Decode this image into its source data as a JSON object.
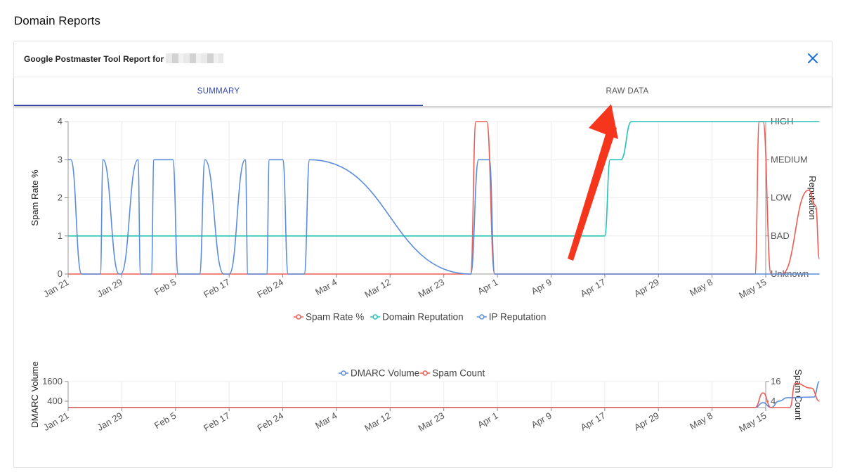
{
  "page": {
    "title": "Domain Reports"
  },
  "report": {
    "title": "Google Postmaster Tool Report for"
  },
  "tabs": [
    {
      "label": "SUMMARY",
      "active": true
    },
    {
      "label": "RAW DATA",
      "active": false
    }
  ],
  "annotation": {
    "type": "red-arrow",
    "color": "#f5351c",
    "target": "RAW DATA tab"
  },
  "chart_data": [
    {
      "type": "line",
      "x_ticks": [
        "Jan 21",
        "Jan 29",
        "Feb 5",
        "Feb 17",
        "Feb 24",
        "Mar 4",
        "Mar 12",
        "Mar 23",
        "Apr 1",
        "Apr 9",
        "Apr 17",
        "Apr 29",
        "May 8",
        "May 15"
      ],
      "ylabel": "Spam Rate %",
      "y_ticks": [
        "0",
        "1",
        "2",
        "3",
        "4"
      ],
      "ylim": [
        0,
        4
      ],
      "y2label": "Reputation",
      "y2_ticks": [
        "Unknown",
        "BAD",
        "LOW",
        "MEDIUM",
        "HIGH"
      ],
      "legend": [
        "Spam Rate %",
        "Domain Reputation",
        "IP Reputation"
      ],
      "legend_position": "bottom",
      "grid": true,
      "series": [
        {
          "name": "Spam Rate %",
          "color": "#ef5b53",
          "x": [
            0,
            7.5,
            7.6,
            7.8,
            7.95,
            12.8,
            12.88,
            12.95,
            13.1,
            13.3,
            13.8,
            13.93,
            14
          ],
          "y": [
            0,
            0,
            4,
            4,
            0,
            0,
            4,
            4,
            0,
            0,
            2.2,
            1.8,
            0.4
          ]
        },
        {
          "name": "Domain Reputation",
          "color": "#22c2b9",
          "x": [
            0,
            10,
            10.1,
            10.3,
            10.5,
            10.65,
            14
          ],
          "y": [
            1,
            1,
            3,
            3,
            4,
            4,
            4
          ]
        },
        {
          "name": "IP Reputation",
          "color": "#5b8ddb",
          "x": [
            0,
            0.05,
            0.25,
            0.28,
            0.6,
            0.65,
            0.95,
            0.98,
            1.3,
            1.35,
            1.55,
            1.6,
            1.95,
            2.05,
            2.45,
            2.55,
            2.9,
            3.0,
            3.3,
            3.35,
            3.7,
            3.75,
            4.0,
            4.1,
            4.4,
            4.5,
            7.5,
            7.65,
            7.85,
            7.95,
            14
          ],
          "y": [
            3,
            3,
            0,
            0,
            0,
            3,
            0,
            0,
            3,
            0,
            0,
            3,
            3,
            0,
            0,
            3,
            0,
            0,
            3,
            0,
            0,
            3,
            3,
            0,
            0,
            3,
            0,
            3,
            3,
            0,
            0
          ]
        }
      ]
    },
    {
      "type": "line",
      "x_ticks": [
        "Jan 21",
        "Jan 29",
        "Feb 5",
        "Feb 17",
        "Feb 24",
        "Mar 4",
        "Mar 12",
        "Mar 23",
        "Apr 1",
        "Apr 9",
        "Apr 17",
        "Apr 29",
        "May 8",
        "May 15"
      ],
      "ylabel": "DMARC Volume",
      "y_ticks": [
        "400",
        "1600"
      ],
      "ylim": [
        0,
        1600
      ],
      "y2label": "Spam Count",
      "y2_ticks": [
        "4",
        "16"
      ],
      "y2lim": [
        0,
        16
      ],
      "legend": [
        "DMARC Volume",
        "Spam Count"
      ],
      "legend_position": "top",
      "grid": true,
      "series": [
        {
          "name": "DMARC Volume",
          "color": "#5b8ddb",
          "x": [
            0,
            12.8,
            12.95,
            13.1,
            13.25,
            13.4,
            13.9,
            14
          ],
          "y": [
            0,
            0,
            300,
            0,
            400,
            600,
            650,
            1600
          ]
        },
        {
          "name": "Spam Count",
          "color": "#ef5b53",
          "x": [
            0,
            12.8,
            12.95,
            13.1,
            13.45,
            13.55,
            13.85,
            14
          ],
          "y": [
            0,
            0,
            9,
            0,
            0,
            15,
            12,
            4
          ]
        }
      ]
    }
  ]
}
